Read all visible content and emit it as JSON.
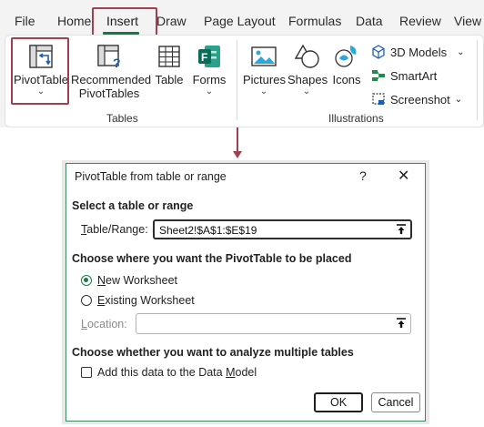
{
  "ribbon": {
    "tabs": [
      {
        "label": "File"
      },
      {
        "label": "Home"
      },
      {
        "label": "Insert"
      },
      {
        "label": "Draw"
      },
      {
        "label": "Page Layout"
      },
      {
        "label": "Formulas"
      },
      {
        "label": "Data"
      },
      {
        "label": "Review"
      },
      {
        "label": "View"
      }
    ],
    "active_tab": "Insert",
    "tables_group": {
      "label": "Tables",
      "pivot_label": "PivotTable",
      "recommended_line1": "Recommended",
      "recommended_line2": "PivotTables",
      "table_label": "Table",
      "forms_label": "Forms"
    },
    "illustrations_group": {
      "label": "Illustrations",
      "pictures_label": "Pictures",
      "shapes_label": "Shapes",
      "icons_label": "Icons",
      "models_label": "3D Models",
      "smartart_label": "SmartArt",
      "screenshot_label": "Screenshot"
    }
  },
  "dialog": {
    "title": "PivotTable from table or range",
    "help": "?",
    "close": "✕",
    "section_select": "Select a table or range",
    "range_label_u": "T",
    "range_label_rest": "able/Range:",
    "range_value": "Sheet2!$A$1:$E$19",
    "section_place": "Choose where you want the PivotTable to be placed",
    "new_ws_u": "N",
    "new_ws_rest": "ew Worksheet",
    "existing_ws_u": "E",
    "existing_ws_rest": "xisting Worksheet",
    "location_u": "L",
    "location_rest": "ocation:",
    "location_value": "",
    "selected_placement": "New Worksheet",
    "section_multiple": "Choose whether you want to analyze multiple tables",
    "data_model_pre": "Add this data to the Data ",
    "data_model_u": "M",
    "data_model_post": "odel",
    "data_model_checked": false,
    "ok_label": "OK",
    "cancel_label": "Cancel"
  },
  "colors": {
    "accent_green": "#117a46",
    "highlight": "#a04050",
    "dialog_border": "#3c8a5d"
  }
}
